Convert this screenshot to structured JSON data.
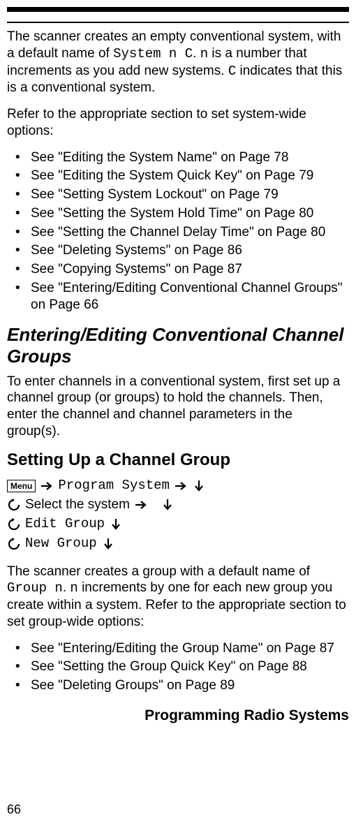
{
  "para1_a": "The scanner creates an empty conventional system, with a default name of ",
  "para1_mono1": "System n       C",
  "para1_b": ". ",
  "para1_mono2": "n",
  "para1_c": " is a number that increments as you add new systems. ",
  "para1_mono3": "C",
  "para1_d": " indicates that this is a conventional system.",
  "para2": "Refer to the appropriate section to set system-wide options:",
  "refs1": [
    "See \"Editing the System Name\" on Page 78",
    "See \"Editing the System Quick Key\" on Page 79",
    "See \"Setting System Lockout\" on Page 79",
    "See \"Setting the System Hold Time\" on Page 80",
    "See \"Setting the Channel Delay Time\" on Page 80",
    "See \"Deleting Systems\" on Page 86",
    "See \"Copying Systems\" on Page 87",
    "See \"Entering/Editing Conventional Channel Groups\" on Page 66"
  ],
  "h2": "Entering/Editing Conventional Channel Groups",
  "para3": "To enter channels in a conventional system, first set up a channel group (or groups) to hold the channels. Then, enter the channel and channel parameters in the group(s).",
  "h3": "Setting Up a Channel Group",
  "menu_label": "Menu",
  "step1_mono": "Program System",
  "step2_text": "Select the system",
  "step3_mono": "Edit Group",
  "step4_mono": "New Group",
  "para4_a": "The scanner creates a group with a default name of ",
  "para4_mono1": "Group n",
  "para4_b": ". ",
  "para4_mono2": "n",
  "para4_c": " increments by one for each new group you create within a system. Refer to the appropriate section to set group-wide options:",
  "refs2": [
    "See \"Entering/Editing the Group Name\" on Page 87",
    "See \"Setting the Group Quick Key\" on Page 88",
    "See \"Deleting Groups\" on Page 89"
  ],
  "footer_title": "Programming Radio Systems",
  "page_num": "66"
}
